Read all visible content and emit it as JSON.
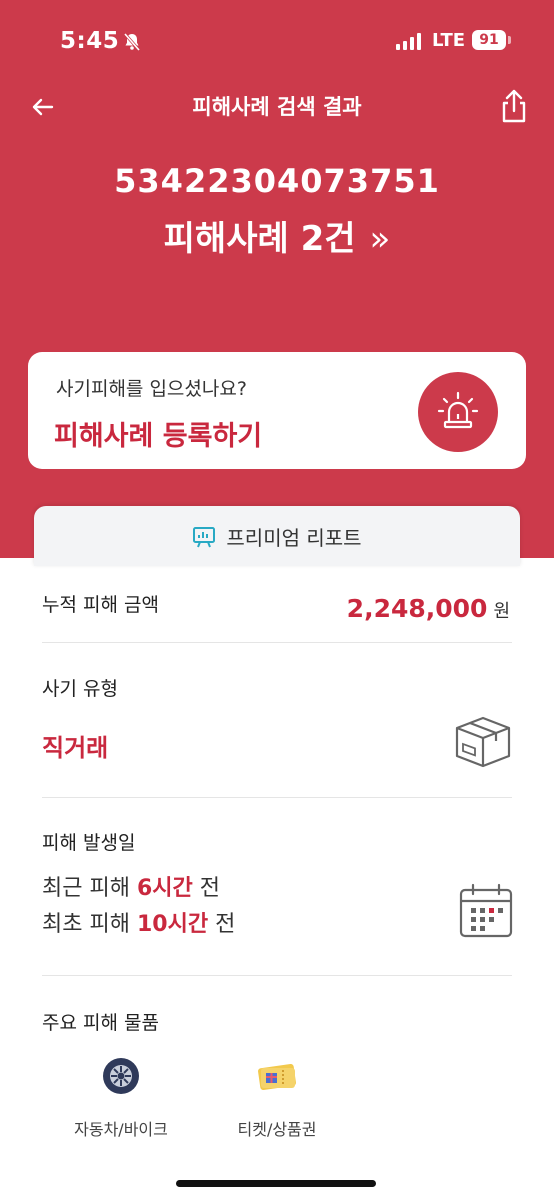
{
  "status_bar": {
    "time": "5:45",
    "network": "LTE",
    "battery": "91"
  },
  "header": {
    "title": "피해사례 검색 결과",
    "back_icon": "arrow-left-icon",
    "share_icon": "share-icon"
  },
  "summary": {
    "account_number": "53422304073751",
    "cases_label": "피해사례 2건",
    "cases_chevron": "»"
  },
  "register_card": {
    "question": "사기피해를 입으셨나요?",
    "action_label": "피해사례 등록하기",
    "icon": "siren-icon"
  },
  "report": {
    "tab_label": "프리미엄 리포트",
    "tab_icon": "presentation-icon",
    "total_damage": {
      "label": "누적 피해 금액",
      "value": "2,248,000",
      "unit": "원"
    },
    "fraud_type": {
      "label": "사기 유형",
      "value": "직거래",
      "icon": "box-icon"
    },
    "damage_date": {
      "label": "피해 발생일",
      "recent_prefix": "최근 피해",
      "recent_value": "6시간",
      "recent_suffix": "전",
      "first_prefix": "최초 피해",
      "first_value": "10시간",
      "first_suffix": "전",
      "icon": "calendar-icon"
    },
    "main_items": {
      "label": "주요 피해 물품",
      "items": [
        {
          "label": "자동차/바이크",
          "icon": "tire-icon"
        },
        {
          "label": "티켓/상품권",
          "icon": "ticket-icon"
        }
      ]
    }
  },
  "colors": {
    "brand_red": "#cc3a4b",
    "accent_text_red": "#c9283e"
  }
}
